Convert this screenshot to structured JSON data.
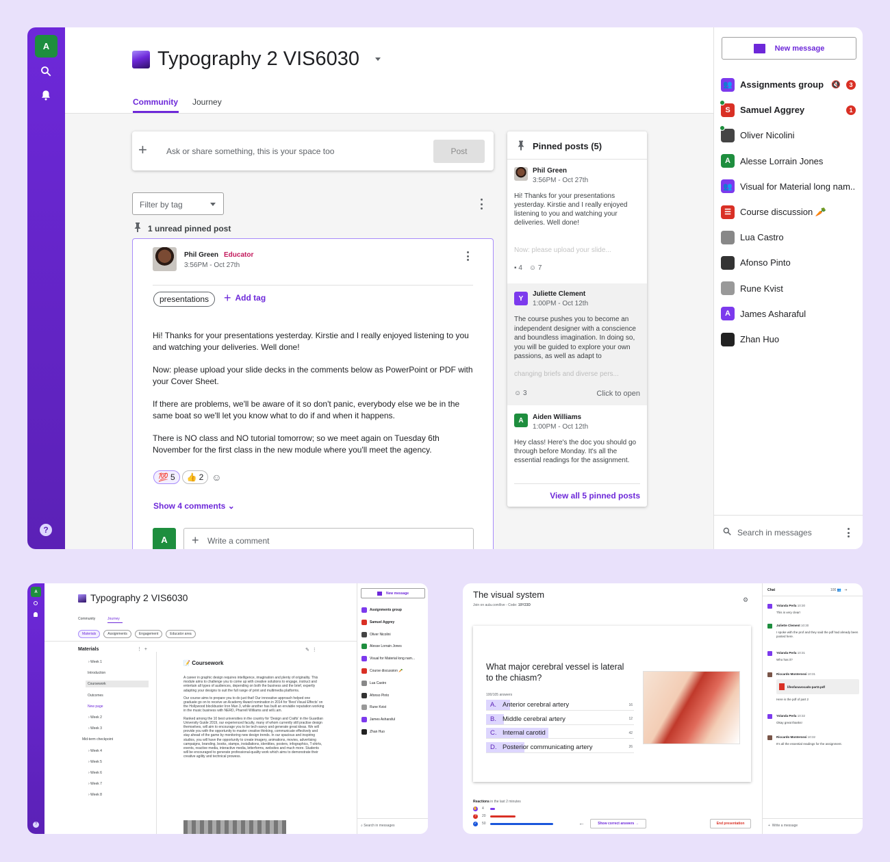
{
  "main": {
    "user_initial": "A",
    "course_title": "Typography 2 VIS6030",
    "tabs": [
      "Community",
      "Journey"
    ],
    "composer_placeholder": "Ask or share something, this is your space too",
    "post_btn": "Post",
    "filter_label": "Filter by tag",
    "unread_pinned": "1 unread pinned post",
    "post": {
      "author": "Phil Green",
      "role": "Educator",
      "time": "3:56PM - Oct 27th",
      "tag": "presentations",
      "add_tag": "Add tag",
      "paragraphs": [
        "Hi! Thanks for your presentations yesterday. Kirstie and I really enjoyed listening to you and watching your deliveries. Well done!",
        "Now: please upload your slide decks in the comments below as PowerPoint or PDF with your Cover Sheet.",
        "If there are problems, we'll be aware of it so don't panic, everybody else we be in the same boat so we'll let you know what to do if and when it happens.",
        "There is NO class and NO tutorial tomorrow; so we meet again on Tuesday 6th November for the first class in the new module where you'll meet the agency."
      ],
      "reactions": [
        {
          "emoji": "💯",
          "count": "5"
        },
        {
          "emoji": "👍",
          "count": "2"
        }
      ],
      "show_comments": "Show 4 comments",
      "comment_initial": "A",
      "comment_placeholder": "Write a comment"
    },
    "pinned": {
      "title": "Pinned posts (5)",
      "items": [
        {
          "author": "Phil Green",
          "time": "3:56PM - Oct 27th",
          "text": "Hi! Thanks for your presentations yesterday. Kirstie and I really enjoyed listening to you and watching your deliveries. Well done!",
          "faded": "Now: please upload your slide...",
          "comments": "4",
          "reactions": "7"
        },
        {
          "author": "Juliette Clement",
          "initial": "Y",
          "time": "1:00PM - Oct 12th",
          "text": "The course pushes you to become an independent designer with a conscience and boundless imagination. In doing so, you will be guided to explore your own passions, as well as adapt to",
          "faded": "changing briefs and diverse pers...",
          "reactions": "3",
          "open": "Click to open"
        },
        {
          "author": "Aiden Williams",
          "initial": "A",
          "time": "1:00PM - Oct 12th",
          "text": "Hey class! Here's the doc you should go through before Monday. It's all the essential readings for the assignment."
        }
      ],
      "view_all": "View all 5 pinned posts"
    },
    "messages": {
      "new_message": "New message",
      "items": [
        {
          "name": "Assignments group",
          "badge": "3",
          "muted": true,
          "bold": true
        },
        {
          "name": "Samuel Aggrey",
          "initial": "S",
          "badge": "1",
          "bold": true,
          "online": true
        },
        {
          "name": "Oliver Nicolini",
          "online": true
        },
        {
          "name": "Alesse Lorrain Jones",
          "initial": "A"
        },
        {
          "name": "Visual for Material long nam..."
        },
        {
          "name": "Course discussion 🥕"
        },
        {
          "name": "Lua Castro"
        },
        {
          "name": "Afonso Pinto"
        },
        {
          "name": "Rune Kvist"
        },
        {
          "name": "James Asharaful",
          "initial": "A"
        },
        {
          "name": "Zhan Huo"
        }
      ],
      "search": "Search in messages"
    }
  },
  "journey": {
    "title": "Typography 2 VIS6030",
    "tabs": [
      "Community",
      "Journey"
    ],
    "chips": [
      "Materials",
      "Assignments",
      "Engagement",
      "Educator area"
    ],
    "materials_label": "Materials",
    "tree": [
      "Week 1",
      "Introduction",
      "Coursework",
      "Outcomes",
      "New page",
      "Week 2",
      "Week 3",
      "Mid-term checkpoint",
      "Week 4",
      "Week 5",
      "Week 6",
      "Week 7",
      "Week 8"
    ],
    "doc_title": "Coursework",
    "doc_paras": [
      "A career in graphic design requires intelligence, imagination and plenty of originality. This module aims to challenge you to come up with creative solutions to engage, instruct and entertain all types of audiences, depending on both the business and the brief, expertly adapting your designs to suit the full range of print and multimedia platforms.",
      "Our course aims to prepare you to do just that! Our innovative approach helped one graduate go on to receive an Academy Award nomination in 2014 for 'Best Visual Effects' on the Hollywood blockbuster Iron Man 3, while another has built an enviable reputation working in the music business with NERD, Pharrell Williams and will.i.am.",
      "Ranked among the 10 best universities in the country for 'Design and Crafts' in the Guardian University Guide 2019, our experienced faculty, many of whom currently still practise design themselves, will aim to encourage you to be tech-savvy and generate great ideas. We will provide you with the opportunity to master creative thinking, communicate effectively and stay ahead of the game by monitoring new design trends. In our spacious and inspiring studios, you will have the opportunity to create imagery, animations, movies, advertising campaigns, branding, books, stamps, installations, identities, posters, infographics, T-shirts, events, reactive media, interactive media, letterforms, websites and much more. Students will be encouraged to generate professional-quality work which aims to demonstrate their creative agility and technical prowess."
    ],
    "new_message": "New message",
    "contacts": [
      "Assignments group",
      "Samuel Aggrey",
      "Oliver Nicolini",
      "Alesse Lorrain Jones",
      "Visual for Material long nam...",
      "Course discussion 🥕",
      "Lua Castro",
      "Afonso Pinto",
      "Rune Kvist",
      "James Asharaful",
      "Zhan Huo"
    ],
    "search": "Search in messages"
  },
  "live": {
    "title": "The visual system",
    "join": "Join on aula.com/live - Code:",
    "code": "19Y23D",
    "question": "What major cerebral vessel is lateral to the chiasm?",
    "answers_count": "100/105 answers",
    "answers": [
      {
        "letter": "A.",
        "text": "Anterior cerebral artery",
        "count": "16",
        "pct": 0.16
      },
      {
        "letter": "B.",
        "text": "Middle cerebral artery",
        "count": "12",
        "pct": 0.12
      },
      {
        "letter": "C.",
        "text": "Internal carotid",
        "count": "42",
        "pct": 0.42
      },
      {
        "letter": "D.",
        "text": "Posterior communicating artery",
        "count": "26",
        "pct": 0.26
      }
    ],
    "reactions_label": "Reactions",
    "reactions_sub": "in the last 2 minutes",
    "reactions": [
      {
        "count": "4",
        "color": "#7c3aed",
        "frac": 0.08
      },
      {
        "count": "20",
        "color": "#d93025",
        "frac": 0.4
      },
      {
        "count": "50",
        "color": "#1a56db",
        "frac": 1.0
      }
    ],
    "show_correct": "Show correct answers",
    "end": "End presentation",
    "chat": {
      "title": "Chat",
      "count": "100",
      "msgs": [
        {
          "name": "Yolanda Perla",
          "time": "10:30",
          "text": "This is very clear!"
        },
        {
          "name": "Juliette Clement",
          "time": "10:30",
          "text": "I spoke with the prof and they said the pdf had already been posted here."
        },
        {
          "name": "Yolanda Perla",
          "time": "10:31",
          "text": "Who has it?"
        },
        {
          "name": "Riccardo Monterossi",
          "time": "10:31",
          "file": "lifeofanavocado-part2.pdf",
          "text": "Here is the pdf of part 2"
        },
        {
          "name": "Yolanda Perla",
          "time": "10:32",
          "text": "Okay great thanks!"
        },
        {
          "name": "Riccardo Monterossi",
          "time": "10:32",
          "text": "It's all the essential readings for the assignment."
        }
      ],
      "placeholder": "Write a message"
    }
  }
}
